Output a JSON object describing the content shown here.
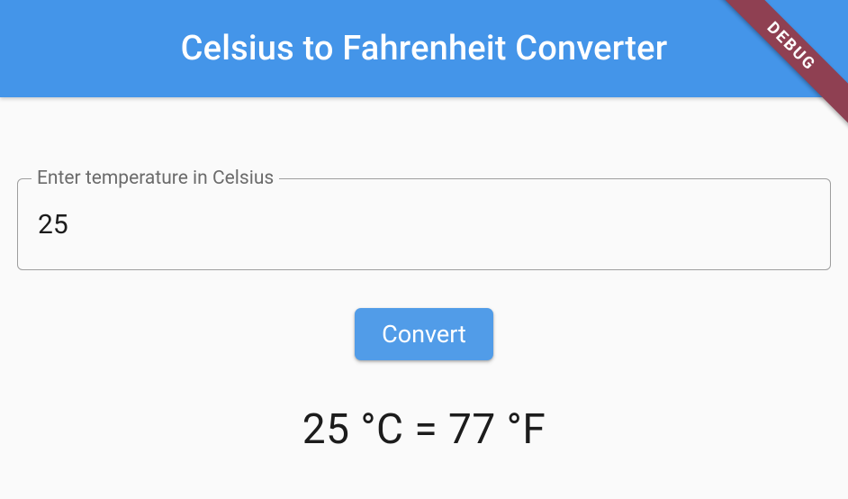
{
  "appbar": {
    "title": "Celsius to Fahrenheit Converter"
  },
  "form": {
    "input_label": "Enter temperature in Celsius",
    "input_value": "25",
    "convert_label": "Convert"
  },
  "result_text": "25 °C = 77 °F",
  "debug_label": "DEBUG"
}
